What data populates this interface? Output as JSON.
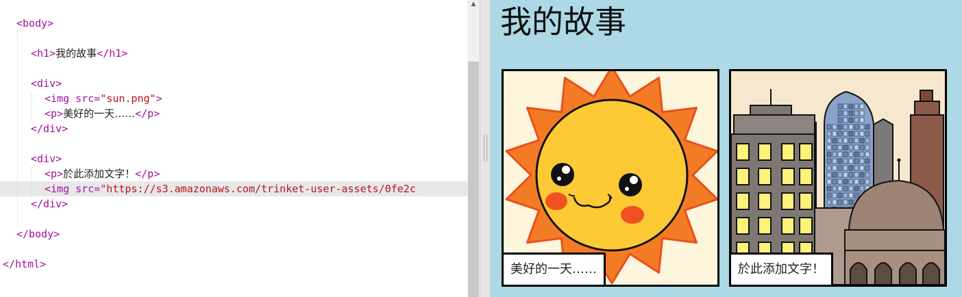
{
  "editor": {
    "lines": [
      {
        "indent": 1,
        "segments": [
          {
            "t": "tag",
            "s": "<body>"
          }
        ]
      },
      {
        "indent": 2,
        "segments": [
          {
            "t": "tag",
            "s": "<h1>"
          },
          {
            "t": "txt",
            "s": "我的故事"
          },
          {
            "t": "tag",
            "s": "</h1>"
          }
        ]
      },
      {
        "indent": 2,
        "segments": [
          {
            "t": "tag",
            "s": "<div>"
          }
        ]
      },
      {
        "indent": 3,
        "segments": [
          {
            "t": "tag",
            "s": "<img "
          },
          {
            "t": "attr",
            "s": "src="
          },
          {
            "t": "str",
            "s": "\"sun.png\""
          },
          {
            "t": "tag",
            "s": ">"
          }
        ]
      },
      {
        "indent": 3,
        "segments": [
          {
            "t": "tag",
            "s": "<p>"
          },
          {
            "t": "txt",
            "s": "美好的一天……"
          },
          {
            "t": "tag",
            "s": "</p>"
          }
        ]
      },
      {
        "indent": 2,
        "segments": [
          {
            "t": "tag",
            "s": "</div>"
          }
        ]
      },
      {
        "indent": 2,
        "segments": [
          {
            "t": "tag",
            "s": "<div>"
          }
        ]
      },
      {
        "indent": 3,
        "segments": [
          {
            "t": "tag",
            "s": "<p>"
          },
          {
            "t": "txt",
            "s": "於此添加文字！"
          },
          {
            "t": "tag",
            "s": "</p>"
          }
        ]
      },
      {
        "indent": 3,
        "segments": [
          {
            "t": "tag",
            "s": "<img "
          },
          {
            "t": "attr",
            "s": "src="
          },
          {
            "t": "str",
            "s": "\"https://s3.amazonaws.com/trinket-user-assets/0fe2c"
          }
        ]
      },
      {
        "indent": 2,
        "segments": [
          {
            "t": "tag",
            "s": "</div>"
          }
        ]
      },
      {
        "indent": 1,
        "segments": [
          {
            "t": "tag",
            "s": "</body>"
          }
        ]
      },
      {
        "indent": 0,
        "segments": [
          {
            "t": "tag",
            "s": "</html>"
          }
        ]
      }
    ],
    "scroll_up_arrow": "▲"
  },
  "preview": {
    "heading": "我的故事",
    "panels": [
      {
        "image": "sun-illustration",
        "caption": "美好的一天……"
      },
      {
        "image": "city-illustration",
        "caption": "於此添加文字！"
      }
    ]
  },
  "colors": {
    "preview_background": "#add8e6",
    "tag": "#a0119a",
    "string": "#b8141a",
    "sun_rays": "#f47b25",
    "sun_face": "#fdc935",
    "cheeks": "#ef4a22"
  }
}
